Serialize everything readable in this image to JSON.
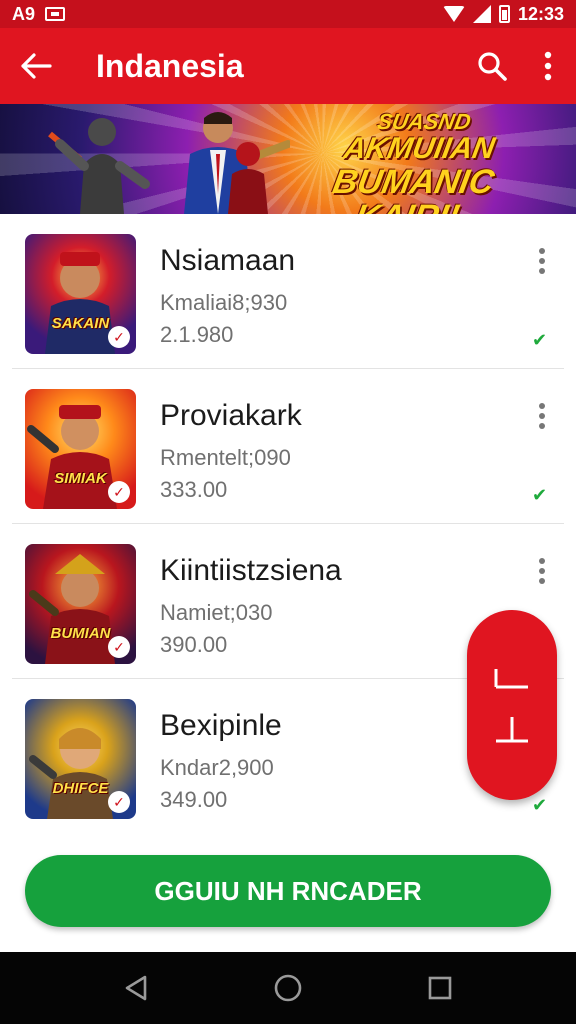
{
  "status_bar": {
    "left_text": "A9",
    "time": "12:33",
    "icons": [
      "notification-box-icon",
      "wifi-icon",
      "signal-icon",
      "battery-icon"
    ]
  },
  "app_bar": {
    "title": "Indanesia",
    "icons": [
      "back-arrow-icon",
      "search-icon",
      "more-vert-icon"
    ]
  },
  "banner": {
    "lines": [
      "SUASND",
      "AKMUIIAN",
      "BUMANIC KAIRI!"
    ]
  },
  "list": {
    "items": [
      {
        "name": "Nsiamaan",
        "subtitle": "Kmaliai8;930",
        "price": "2.1.980",
        "thumb_label": "SAKAIN",
        "thumb_colors": [
          "#3a1a7a",
          "#d31d2a"
        ]
      },
      {
        "name": "Proviakark",
        "subtitle": "Rmentelt;090",
        "price": "333.00",
        "thumb_label": "SIMIAK",
        "thumb_colors": [
          "#ff8a1a",
          "#d61a1a"
        ]
      },
      {
        "name": "Kiintiistzsiena",
        "subtitle": "Namiet;030",
        "price": "390.00",
        "thumb_label": "BUMIAN",
        "thumb_colors": [
          "#2c1240",
          "#b9161e"
        ]
      },
      {
        "name": "Bexipinle",
        "subtitle": "Kndar2,900",
        "price": "349.00",
        "thumb_label": "DHIFCE",
        "thumb_colors": [
          "#1e3a8a",
          "#d9a21b"
        ]
      }
    ]
  },
  "fab": {
    "icon": "bracket-icon"
  },
  "primary_button": {
    "label": "GGUIU NH RNCADER"
  },
  "nav_bar": {
    "icons": [
      "back-triangle-icon",
      "home-circle-icon",
      "recents-square-icon"
    ]
  },
  "colors": {
    "status_bar": "#c5101c",
    "app_bar": "#e01520",
    "primary_button": "#16a13d",
    "nav_bar": "#050505",
    "check": "#1faa3c"
  }
}
